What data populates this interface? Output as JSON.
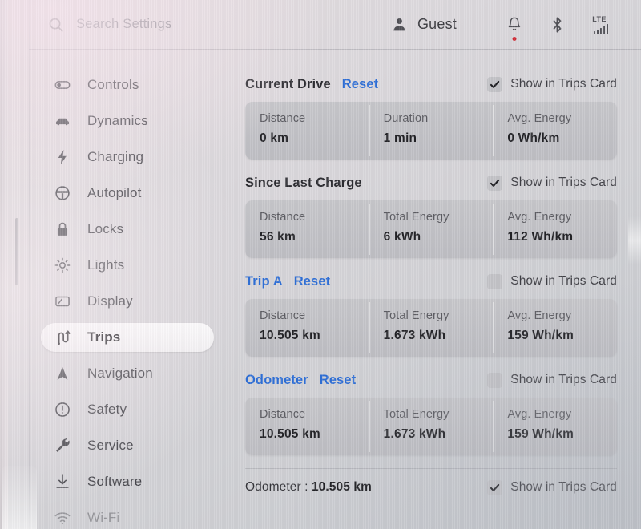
{
  "topbar": {
    "search": {
      "icon": "search-icon",
      "value": "",
      "placeholder": "Search Settings"
    },
    "profile": {
      "icon": "person-icon",
      "name": "Guest"
    },
    "notifications": {
      "icon": "bell-icon",
      "has_badge": true
    },
    "bluetooth": {
      "icon": "bluetooth-icon"
    },
    "cellular": {
      "icon": "signal-bars-icon",
      "label": "LTE",
      "bars": 5
    }
  },
  "sidebar": {
    "items": [
      {
        "icon": "toggle-icon",
        "label": "Controls",
        "active": false,
        "faded": false
      },
      {
        "icon": "car-icon",
        "label": "Dynamics",
        "active": false,
        "faded": false
      },
      {
        "icon": "bolt-icon",
        "label": "Charging",
        "active": false,
        "faded": false
      },
      {
        "icon": "steering-wheel-icon",
        "label": "Autopilot",
        "active": false,
        "faded": false
      },
      {
        "icon": "lock-icon",
        "label": "Locks",
        "active": false,
        "faded": false
      },
      {
        "icon": "sun-icon",
        "label": "Lights",
        "active": false,
        "faded": false
      },
      {
        "icon": "display-icon",
        "label": "Display",
        "active": false,
        "faded": false
      },
      {
        "icon": "winding-road-icon",
        "label": "Trips",
        "active": true,
        "faded": false
      },
      {
        "icon": "navigation-arrow-icon",
        "label": "Navigation",
        "active": false,
        "faded": false
      },
      {
        "icon": "alert-circle-icon",
        "label": "Safety",
        "active": false,
        "faded": false
      },
      {
        "icon": "wrench-icon",
        "label": "Service",
        "active": false,
        "faded": false
      },
      {
        "icon": "download-icon",
        "label": "Software",
        "active": false,
        "faded": false
      },
      {
        "icon": "wifi-icon",
        "label": "Wi-Fi",
        "active": false,
        "faded": true
      }
    ]
  },
  "content": {
    "show_in_trips_card_label": "Show in Trips Card",
    "reset_label": "Reset",
    "sections": [
      {
        "title": "Current Drive",
        "title_is_link": false,
        "has_reset": true,
        "checked": true,
        "stats": [
          {
            "key": "Distance",
            "value": "0 km"
          },
          {
            "key": "Duration",
            "value": "1 min"
          },
          {
            "key": "Avg. Energy",
            "value": "0 Wh/km"
          }
        ]
      },
      {
        "title": "Since Last Charge",
        "title_is_link": false,
        "has_reset": false,
        "checked": true,
        "stats": [
          {
            "key": "Distance",
            "value": "56 km"
          },
          {
            "key": "Total Energy",
            "value": "6 kWh"
          },
          {
            "key": "Avg. Energy",
            "value": "112 Wh/km"
          }
        ]
      },
      {
        "title": "Trip A",
        "title_is_link": true,
        "has_reset": true,
        "checked": false,
        "stats": [
          {
            "key": "Distance",
            "value": "10.505 km"
          },
          {
            "key": "Total Energy",
            "value": "1.673 kWh"
          },
          {
            "key": "Avg. Energy",
            "value": "159 Wh/km"
          }
        ]
      },
      {
        "title": "Odometer",
        "title_is_link": true,
        "has_reset": true,
        "checked": false,
        "stats": [
          {
            "key": "Distance",
            "value": "10.505 km"
          },
          {
            "key": "Total Energy",
            "value": "1.673 kWh"
          },
          {
            "key": "Avg. Energy",
            "value": "159 Wh/km"
          }
        ]
      }
    ],
    "odometer_row": {
      "label": "Odometer :",
      "value": "10.505 km",
      "checked": true
    }
  },
  "colors": {
    "accent_blue": "#2f6fd6",
    "badge_red": "#d02a35",
    "card_gray": "#c3c3c7",
    "text_dark": "#232327"
  }
}
